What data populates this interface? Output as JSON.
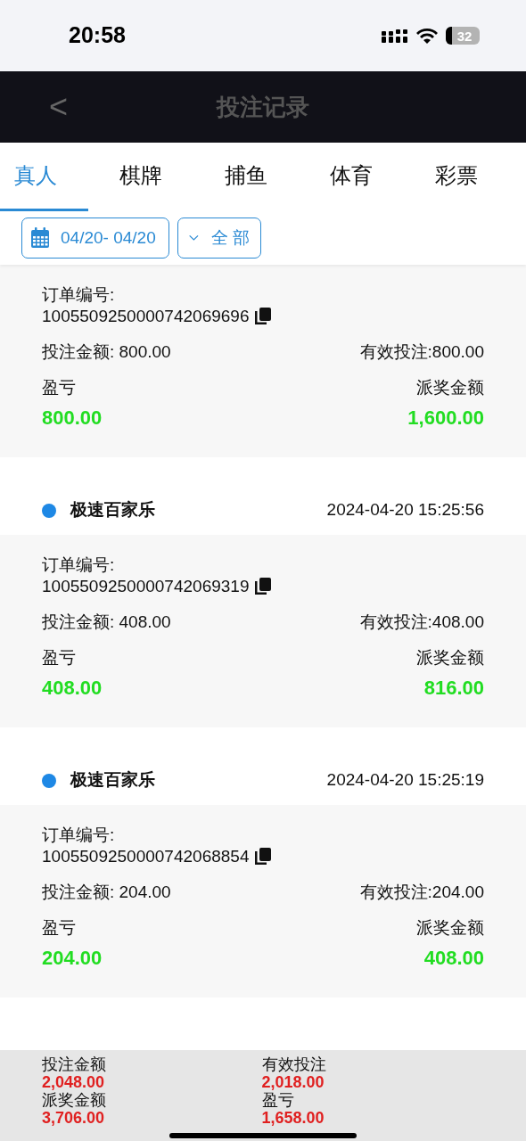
{
  "status_bar": {
    "time": "20:58",
    "battery": "32"
  },
  "header": {
    "back": "<",
    "title": "投注记录"
  },
  "tabs": [
    {
      "label": "真人",
      "selected": true
    },
    {
      "label": "棋牌",
      "selected": false
    },
    {
      "label": "捕鱼",
      "selected": false
    },
    {
      "label": "体育",
      "selected": false
    },
    {
      "label": "彩票",
      "selected": false
    }
  ],
  "filters": {
    "date_range": "04/20- 04/20",
    "type": "全 部"
  },
  "records": [
    {
      "order_label": "订单编号:",
      "order_no": "1005509250000742069696",
      "bet_label": "投注金额: 800.00",
      "valid_label": "有效投注:800.00",
      "profit_label": "盈亏",
      "profit": "800.00",
      "payout_label": "派奖金额",
      "payout": "1,600.00"
    },
    {
      "game": "极速百家乐",
      "time": "2024-04-20 15:25:56",
      "order_label": "订单编号:",
      "order_no": "1005509250000742069319",
      "bet_label": "投注金额: 408.00",
      "valid_label": "有效投注:408.00",
      "profit_label": "盈亏",
      "profit": "408.00",
      "payout_label": "派奖金额",
      "payout": "816.00"
    },
    {
      "game": "极速百家乐",
      "time": "2024-04-20 15:25:19",
      "order_label": "订单编号:",
      "order_no": "1005509250000742068854",
      "bet_label": "投注金额: 204.00",
      "valid_label": "有效投注:204.00",
      "profit_label": "盈亏",
      "profit": "204.00",
      "payout_label": "派奖金额",
      "payout": "408.00"
    }
  ],
  "summary": [
    {
      "label": "投注金额",
      "value": "2,048.00"
    },
    {
      "label": "有效投注",
      "value": "2,018.00"
    },
    {
      "label": "派奖金额",
      "value": "3,706.00"
    },
    {
      "label": "盈亏",
      "value": "1,658.00"
    }
  ]
}
